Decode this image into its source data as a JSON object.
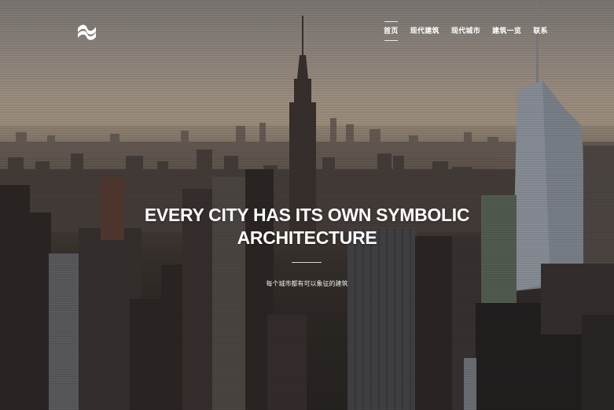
{
  "nav": {
    "items": [
      {
        "label": "首页",
        "active": true
      },
      {
        "label": "现代建筑",
        "active": false
      },
      {
        "label": "现代城市",
        "active": false
      },
      {
        "label": "建筑一览",
        "active": false
      },
      {
        "label": "联系",
        "active": false
      }
    ]
  },
  "hero": {
    "title_line1": "EVERY CITY HAS ITS OWN SYMBOLIC",
    "title_line2": "ARCHITECTURE",
    "subtitle": "每个城市都有可以象征的建筑"
  },
  "logo": {
    "icon": "wave-logo-icon",
    "color": "#ffffff"
  }
}
